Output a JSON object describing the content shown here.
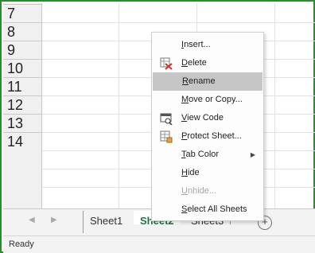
{
  "rows": [
    "7",
    "8",
    "9",
    "10",
    "11",
    "12",
    "13",
    "14"
  ],
  "menu": {
    "items": [
      {
        "key": "I",
        "rest": "nsert..."
      },
      {
        "key": "D",
        "rest": "elete"
      },
      {
        "key": "R",
        "rest": "ename"
      },
      {
        "key": "M",
        "rest": "ove or Copy..."
      },
      {
        "key": "V",
        "rest": "iew Code"
      },
      {
        "key": "P",
        "rest": "rotect Sheet..."
      },
      {
        "key": "T",
        "rest": "ab Color"
      },
      {
        "key": "H",
        "rest": "ide"
      },
      {
        "key": "U",
        "rest": "nhide..."
      },
      {
        "key": "S",
        "rest": "elect All Sheets"
      }
    ]
  },
  "tabs": {
    "sheet1": "Sheet1",
    "sheet2": "Sheet2",
    "sheet3": "Sheet3",
    "add": "+"
  },
  "status": {
    "text": "Ready"
  },
  "colors": {
    "accent": "#217346",
    "frame": "#2f8a2f",
    "selected": "#c6c6c6"
  }
}
